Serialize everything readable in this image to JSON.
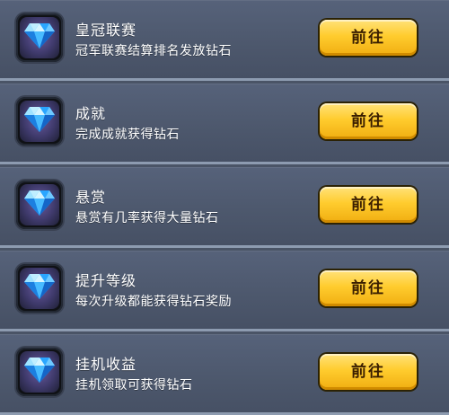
{
  "accent_colors": {
    "background": "#4a5466",
    "divider": "#95a3b8",
    "button": "#ffcc2e",
    "diamond": "#2aa6ff"
  },
  "rows": [
    {
      "icon": "diamond-icon",
      "title": "皇冠联赛",
      "desc": "冠军联赛结算排名发放钻石",
      "button": "前往"
    },
    {
      "icon": "diamond-icon",
      "title": "成就",
      "desc": "完成成就获得钻石",
      "button": "前往"
    },
    {
      "icon": "diamond-icon",
      "title": "悬赏",
      "desc": "悬赏有几率获得大量钻石",
      "button": "前往"
    },
    {
      "icon": "diamond-icon",
      "title": "提升等级",
      "desc": "每次升级都能获得钻石奖励",
      "button": "前往"
    },
    {
      "icon": "diamond-icon",
      "title": "挂机收益",
      "desc": "挂机领取可获得钻石",
      "button": "前往"
    }
  ]
}
